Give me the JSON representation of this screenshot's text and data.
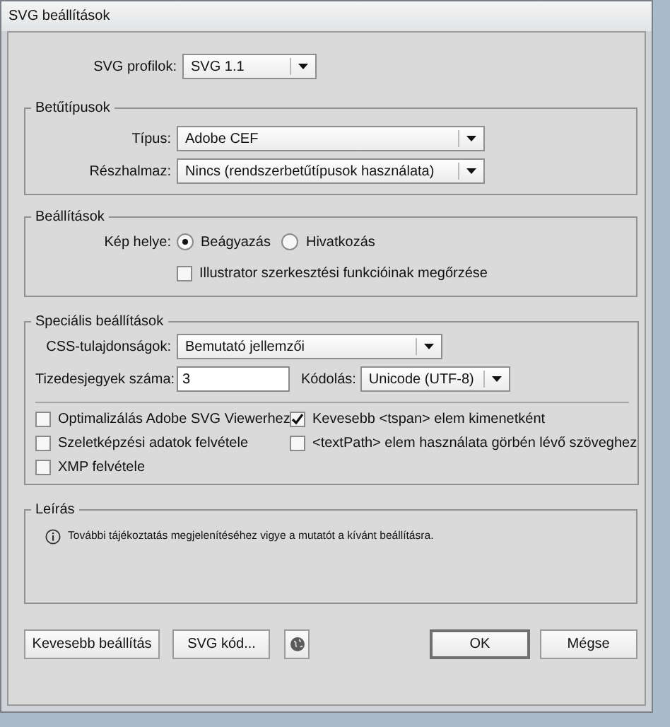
{
  "window": {
    "title": "SVG beállítások"
  },
  "profile": {
    "label": "SVG profilok:",
    "value": "SVG 1.1"
  },
  "fonts": {
    "title": "Betűtípusok",
    "rows": [
      {
        "label": "Típus:",
        "value": "Adobe CEF"
      },
      {
        "label": "Részhalmaz:",
        "value": "Nincs (rendszerbetűtípusok használata)"
      }
    ]
  },
  "options": {
    "title": "Beállítások",
    "image_location": {
      "label": "Kép helye:",
      "radios": [
        {
          "label": "Beágyazás",
          "selected": true
        },
        {
          "label": "Hivatkozás",
          "selected": false
        }
      ]
    },
    "checkbox": {
      "label": "Illustrator szerkesztési funkcióinak megőrzése",
      "checked": false
    }
  },
  "advanced": {
    "title": "Speciális beállítások",
    "css": {
      "label": "CSS-tulajdonságok:",
      "value": "Bemutató jellemzői"
    },
    "decimals": {
      "label": "Tizedesjegyek száma:",
      "value": "3"
    },
    "encoding": {
      "label": "Kódolás:",
      "value": "Unicode (UTF-8)"
    },
    "checkboxes": [
      {
        "label": "Optimalizálás Adobe SVG Viewerhez",
        "checked": false
      },
      {
        "label": "Kevesebb <tspan> elem kimenetként",
        "checked": true
      },
      {
        "label": "Szeletképzési adatok felvétele",
        "checked": false
      },
      {
        "label": "<textPath> elem használata görbén lévő szöveghez",
        "checked": false
      },
      {
        "label": "XMP felvétele",
        "checked": false
      }
    ]
  },
  "description": {
    "title": "Leírás",
    "text": "További tájékoztatás megjelenítéséhez vigye a mutatót a kívánt beállításra."
  },
  "buttons": [
    {
      "kind": "text",
      "label": "Kevesebb beállítás"
    },
    {
      "kind": "text",
      "label": "SVG kód..."
    },
    {
      "kind": "globe"
    },
    {
      "kind": "default",
      "label": "OK"
    },
    {
      "kind": "text",
      "label": "Mégse"
    }
  ]
}
